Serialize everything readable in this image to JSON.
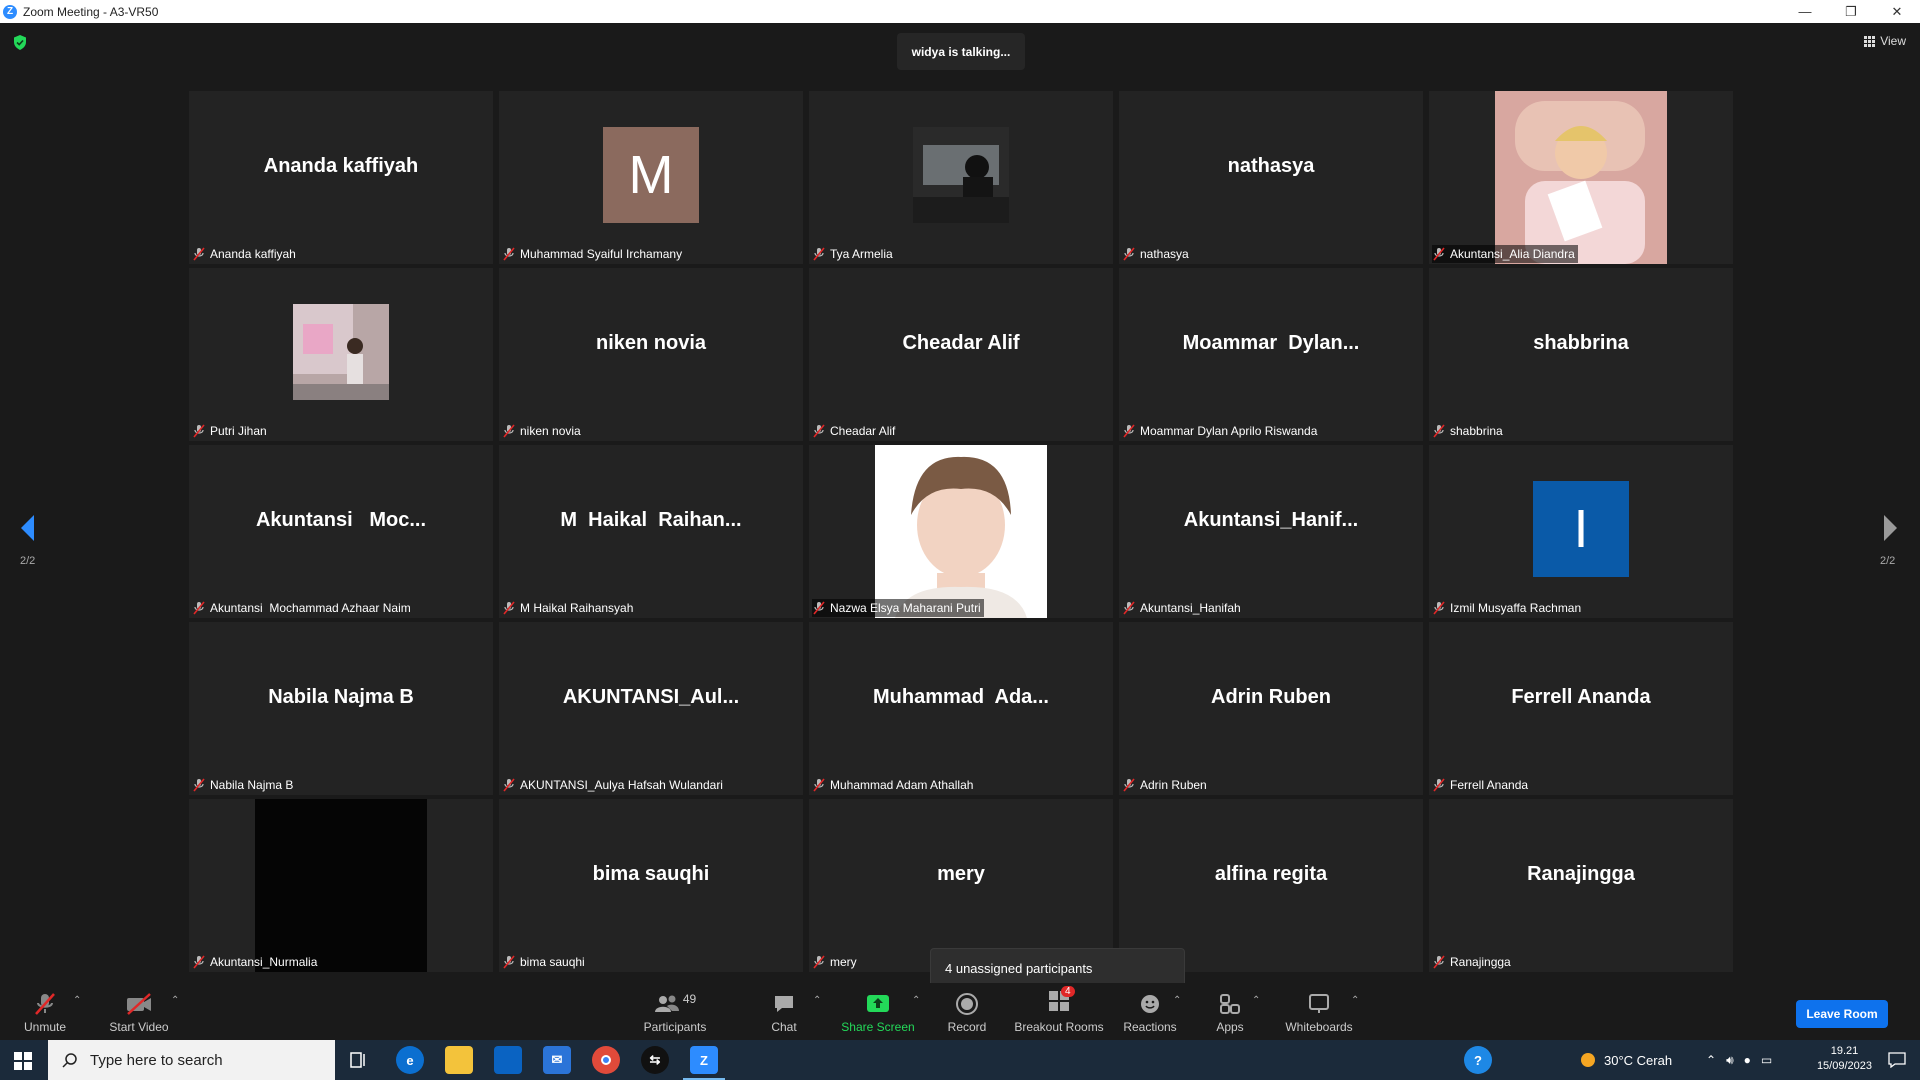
{
  "window": {
    "title": "Zoom Meeting - A3-VR50",
    "minimize": "—",
    "restore": "❐",
    "close": "✕"
  },
  "status": {
    "talking": "widya is talking...",
    "view_label": "View"
  },
  "pager": {
    "left_label": "2/2",
    "right_label": "2/2"
  },
  "tiles": [
    {
      "big": "Ananda kaffiyah",
      "label": "Ananda kaffiyah"
    },
    {
      "big": "",
      "letter": "M",
      "letter_color": "#8b6a5e",
      "label": "Muhammad Syaiful Irchamany"
    },
    {
      "big": "",
      "photo": "car-interior",
      "label": "Tya Armelia"
    },
    {
      "big": "nathasya",
      "label": "nathasya"
    },
    {
      "big": "",
      "photo": "sleeping-girl",
      "label": "Akuntansi_Alia Diandra"
    },
    {
      "big": "",
      "photo": "child-wall",
      "label": "Putri Jihan"
    },
    {
      "big": "niken novia",
      "label": "niken novia"
    },
    {
      "big": "Cheadar Alif",
      "label": "Cheadar Alif"
    },
    {
      "big": "Moammar  Dylan...",
      "label": "Moammar Dylan Aprilo Riswanda"
    },
    {
      "big": "shabbrina",
      "label": "shabbrina"
    },
    {
      "big": "Akuntansi   Moc...",
      "label": "Akuntansi  Mochammad Azhaar Naim"
    },
    {
      "big": "M  Haikal  Raihan...",
      "label": "M Haikal Raihansyah"
    },
    {
      "big": "",
      "photo": "portrait",
      "label": "Nazwa Elsya Maharani Putri"
    },
    {
      "big": "Akuntansi_Hanif...",
      "label": "Akuntansi_Hanifah"
    },
    {
      "big": "",
      "letter": "I",
      "letter_color": "#0a5aa8",
      "label": "Izmil Musyaffa Rachman"
    },
    {
      "big": "Nabila Najma B",
      "label": "Nabila Najma B"
    },
    {
      "big": "AKUNTANSI_Aul...",
      "label": "AKUNTANSI_Aulya Hafsah Wulandari"
    },
    {
      "big": "Muhammad  Ada...",
      "label": "Muhammad Adam Athallah"
    },
    {
      "big": "Adrin Ruben",
      "label": "Adrin Ruben"
    },
    {
      "big": "Ferrell Ananda",
      "label": "Ferrell Ananda"
    },
    {
      "big": "",
      "photo": "black",
      "label": "Akuntansi_Nurmalia"
    },
    {
      "big": "bima sauqhi",
      "label": "bima sauqhi"
    },
    {
      "big": "mery",
      "label": "mery"
    },
    {
      "big": "alfina regita",
      "label": "gita"
    },
    {
      "big": "Ranajingga",
      "label": "Ranajingga"
    }
  ],
  "tooltip": "4 unassigned participants",
  "toolbar": {
    "unmute": "Unmute",
    "start_video": "Start Video",
    "participants": "Participants",
    "participants_count": "49",
    "chat": "Chat",
    "share_screen": "Share Screen",
    "record": "Record",
    "breakout_rooms": "Breakout Rooms",
    "breakout_badge": "4",
    "reactions": "Reactions",
    "apps": "Apps",
    "whiteboards": "Whiteboards",
    "leave": "Leave Room",
    "share_color": "#23d959",
    "leave_color": "#0e72ed"
  },
  "taskbar": {
    "search_placeholder": "Type here to search",
    "weather": "30°C  Cerah",
    "time": "19.21",
    "date": "15/09/2023"
  }
}
